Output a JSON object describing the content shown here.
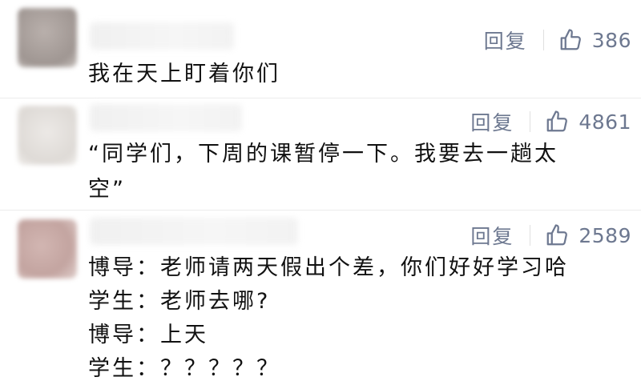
{
  "comments": [
    {
      "reply_label": "回复",
      "likes": "386",
      "lines": [
        "我在天上盯着你们"
      ]
    },
    {
      "reply_label": "回复",
      "likes": "4861",
      "lines": [
        "“同学们，下周的课暂停一下。我要去一趟太",
        "空”"
      ]
    },
    {
      "reply_label": "回复",
      "likes": "2589",
      "lines": [
        "博导：老师请两天假出个差，你们好好学习哈",
        "学生：老师去哪?",
        "博导：上天",
        "学生：？？？？？"
      ]
    }
  ],
  "icons": {
    "like": "thumbs-up-icon"
  },
  "colors": {
    "meta_text": "#6d7890",
    "body_text": "#111111",
    "background": "#ffffff"
  }
}
